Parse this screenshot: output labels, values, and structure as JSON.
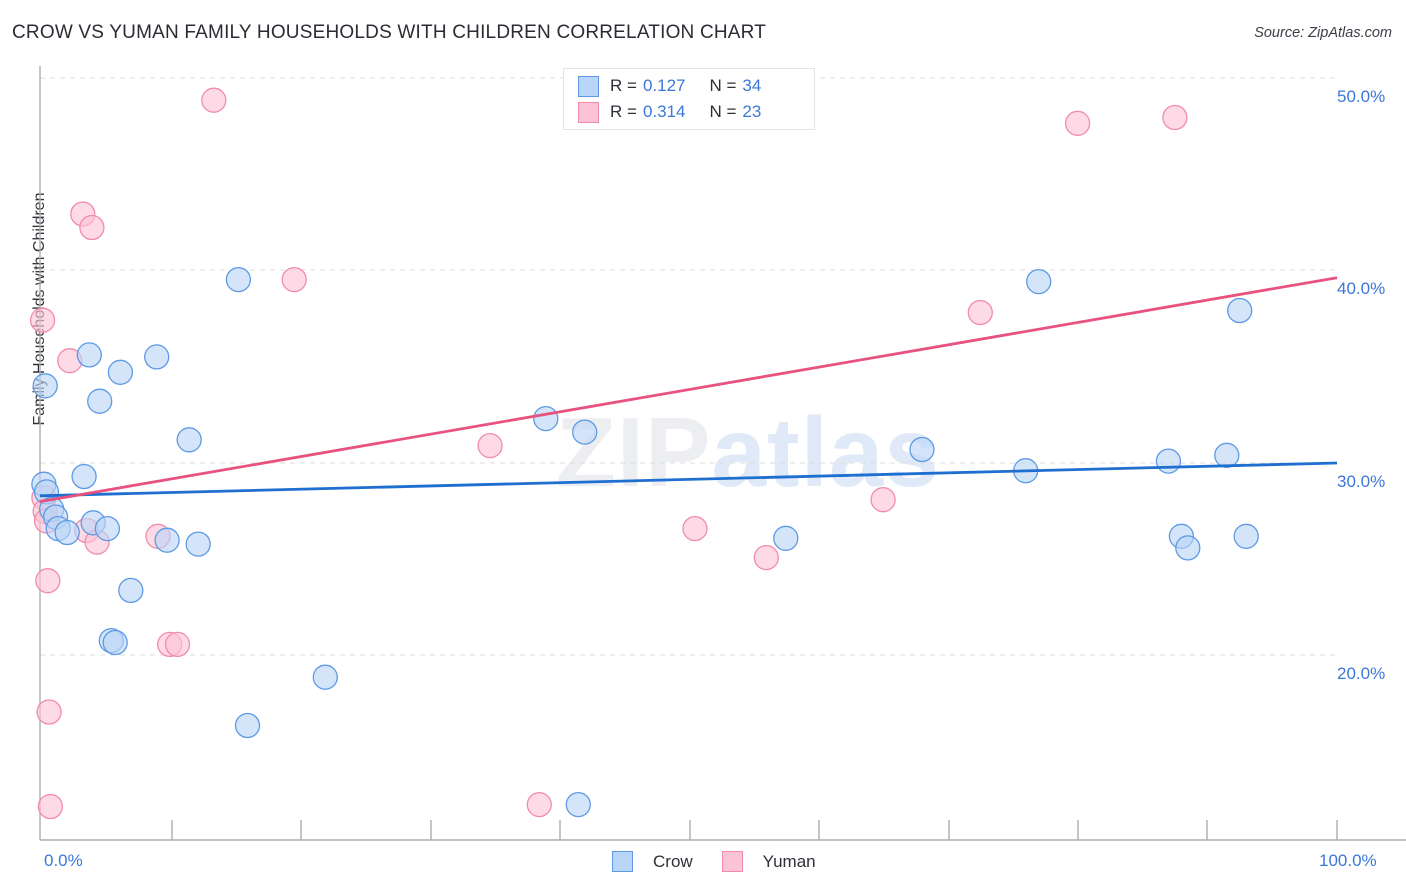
{
  "header": {
    "title": "CROW VS YUMAN FAMILY HOUSEHOLDS WITH CHILDREN CORRELATION CHART",
    "source": "Source: ZipAtlas.com"
  },
  "watermark": {
    "part1": "ZIP",
    "part2": "atlas"
  },
  "legend_top": {
    "rows": [
      {
        "series": "Crow",
        "color": "#b9d5f7",
        "r_label": "R =",
        "r_value": "0.127",
        "n_label": "N =",
        "n_value": "34"
      },
      {
        "series": "Yuman",
        "color": "#fbc4d6",
        "r_label": "R =",
        "r_value": "0.314",
        "n_label": "N =",
        "n_value": "23"
      }
    ]
  },
  "legend_bottom": {
    "items": [
      {
        "label": "Crow",
        "color": "#b9d5f7"
      },
      {
        "label": "Yuman",
        "color": "#fbc4d6"
      }
    ]
  },
  "axes": {
    "y_title": "Family Households with Children",
    "y_ticks": [
      "50.0%",
      "40.0%",
      "30.0%",
      "20.0%"
    ],
    "x_ticks": [
      "0.0%",
      "100.0%"
    ]
  },
  "chart_data": {
    "type": "scatter",
    "title": "Crow vs Yuman Family Households with Children Correlation Chart",
    "xlabel": "",
    "ylabel": "Family Households with Children",
    "xlim": [
      0,
      100
    ],
    "ylim": [
      11.5,
      52.5
    ],
    "grid": true,
    "legend_position": "top-center",
    "axis_units": "percent",
    "series": [
      {
        "name": "Crow",
        "color": "#b9d5f7",
        "edge_color": "#5e9ae3",
        "R": 0.127,
        "N": 34,
        "trendline": {
          "x0": 0,
          "y0": 28.3,
          "x1": 100,
          "y1": 30.0
        },
        "points": [
          [
            0.4,
            34.0
          ],
          [
            0.3,
            28.9
          ],
          [
            0.5,
            28.5
          ],
          [
            0.9,
            27.6
          ],
          [
            1.2,
            27.2
          ],
          [
            1.4,
            26.6
          ],
          [
            2.1,
            26.4
          ],
          [
            3.4,
            29.3
          ],
          [
            3.8,
            35.6
          ],
          [
            4.1,
            26.9
          ],
          [
            4.6,
            33.2
          ],
          [
            5.2,
            26.6
          ],
          [
            5.5,
            20.8
          ],
          [
            5.8,
            20.7
          ],
          [
            6.2,
            34.7
          ],
          [
            7.0,
            23.4
          ],
          [
            9.0,
            35.5
          ],
          [
            11.5,
            31.2
          ],
          [
            9.8,
            26.0
          ],
          [
            12.2,
            25.8
          ],
          [
            15.3,
            39.5
          ],
          [
            16.0,
            16.4
          ],
          [
            22.0,
            18.9
          ],
          [
            39.0,
            32.3
          ],
          [
            42.0,
            31.6
          ],
          [
            41.5,
            12.3
          ],
          [
            57.5,
            26.1
          ],
          [
            68.0,
            30.7
          ],
          [
            77.0,
            39.4
          ],
          [
            76.0,
            29.6
          ],
          [
            87.0,
            30.1
          ],
          [
            91.5,
            30.4
          ],
          [
            88.0,
            26.2
          ],
          [
            88.5,
            25.6
          ],
          [
            92.5,
            37.9
          ],
          [
            93.0,
            26.2
          ]
        ]
      },
      {
        "name": "Yuman",
        "color": "#fbc4d6",
        "edge_color": "#f18cab",
        "R": 0.314,
        "N": 23,
        "trendline": {
          "x0": 0,
          "y0": 28.0,
          "x1": 100,
          "y1": 39.6
        },
        "points": [
          [
            0.2,
            37.4
          ],
          [
            0.3,
            28.2
          ],
          [
            0.4,
            27.5
          ],
          [
            0.5,
            27.0
          ],
          [
            0.6,
            23.9
          ],
          [
            0.7,
            17.1
          ],
          [
            0.8,
            12.2
          ],
          [
            2.3,
            35.3
          ],
          [
            3.3,
            42.9
          ],
          [
            4.0,
            42.2
          ],
          [
            3.6,
            26.5
          ],
          [
            4.4,
            25.9
          ],
          [
            9.1,
            26.2
          ],
          [
            10.0,
            20.6
          ],
          [
            10.6,
            20.6
          ],
          [
            13.4,
            48.8
          ],
          [
            19.6,
            39.5
          ],
          [
            34.7,
            30.9
          ],
          [
            38.5,
            12.3
          ],
          [
            50.5,
            26.6
          ],
          [
            56.0,
            25.1
          ],
          [
            65.0,
            28.1
          ],
          [
            72.5,
            37.8
          ],
          [
            80.0,
            47.6
          ],
          [
            87.5,
            47.9
          ]
        ]
      }
    ]
  }
}
